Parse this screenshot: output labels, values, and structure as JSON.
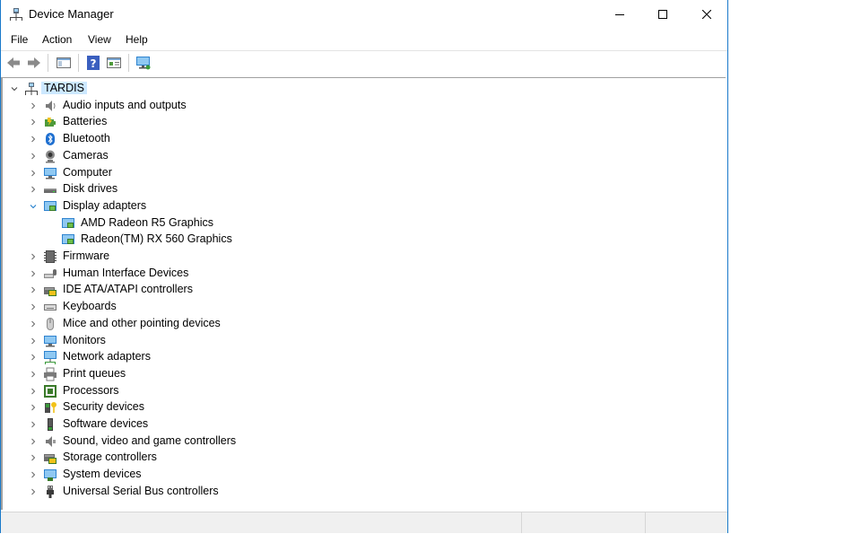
{
  "window": {
    "title": "Device Manager",
    "border_color": "#1979ca",
    "controls": [
      "minimize-icon",
      "maximize-icon",
      "close-icon"
    ]
  },
  "menu": {
    "items": [
      "File",
      "Action",
      "View",
      "Help"
    ]
  },
  "toolbar": {
    "buttons": [
      "back-arrow-icon",
      "forward-arrow-icon",
      "show-hide-console-tree-icon",
      "help-icon",
      "properties-icon",
      "monitor-network-icon"
    ]
  },
  "tree": {
    "root": {
      "label": "TARDIS",
      "icon": "computer-network-icon",
      "expanded": true,
      "selected": true
    },
    "categories": [
      {
        "label": "Audio inputs and outputs",
        "icon": "speaker-icon"
      },
      {
        "label": "Batteries",
        "icon": "battery-icon"
      },
      {
        "label": "Bluetooth",
        "icon": "bluetooth-icon"
      },
      {
        "label": "Cameras",
        "icon": "camera-icon"
      },
      {
        "label": "Computer",
        "icon": "computer-icon"
      },
      {
        "label": "Disk drives",
        "icon": "disk-drive-icon"
      },
      {
        "label": "Display adapters",
        "icon": "display-adapter-icon",
        "expanded": true,
        "children": [
          {
            "label": "AMD Radeon R5 Graphics",
            "icon": "display-adapter-icon"
          },
          {
            "label": "Radeon(TM) RX 560 Graphics",
            "icon": "display-adapter-icon"
          }
        ]
      },
      {
        "label": "Firmware",
        "icon": "firmware-icon"
      },
      {
        "label": "Human Interface Devices",
        "icon": "hid-icon"
      },
      {
        "label": "IDE ATA/ATAPI controllers",
        "icon": "ide-controller-icon"
      },
      {
        "label": "Keyboards",
        "icon": "keyboard-icon"
      },
      {
        "label": "Mice and other pointing devices",
        "icon": "mouse-icon"
      },
      {
        "label": "Monitors",
        "icon": "monitor-icon"
      },
      {
        "label": "Network adapters",
        "icon": "network-adapter-icon"
      },
      {
        "label": "Print queues",
        "icon": "printer-icon"
      },
      {
        "label": "Processors",
        "icon": "processor-icon"
      },
      {
        "label": "Security devices",
        "icon": "security-key-icon"
      },
      {
        "label": "Software devices",
        "icon": "software-device-icon"
      },
      {
        "label": "Sound, video and game controllers",
        "icon": "sound-icon"
      },
      {
        "label": "Storage controllers",
        "icon": "storage-controller-icon"
      },
      {
        "label": "System devices",
        "icon": "system-devices-icon"
      },
      {
        "label": "Universal Serial Bus controllers",
        "icon": "usb-icon"
      }
    ]
  },
  "colors": {
    "selection": "#cce8ff",
    "accent": "#1979ca"
  }
}
